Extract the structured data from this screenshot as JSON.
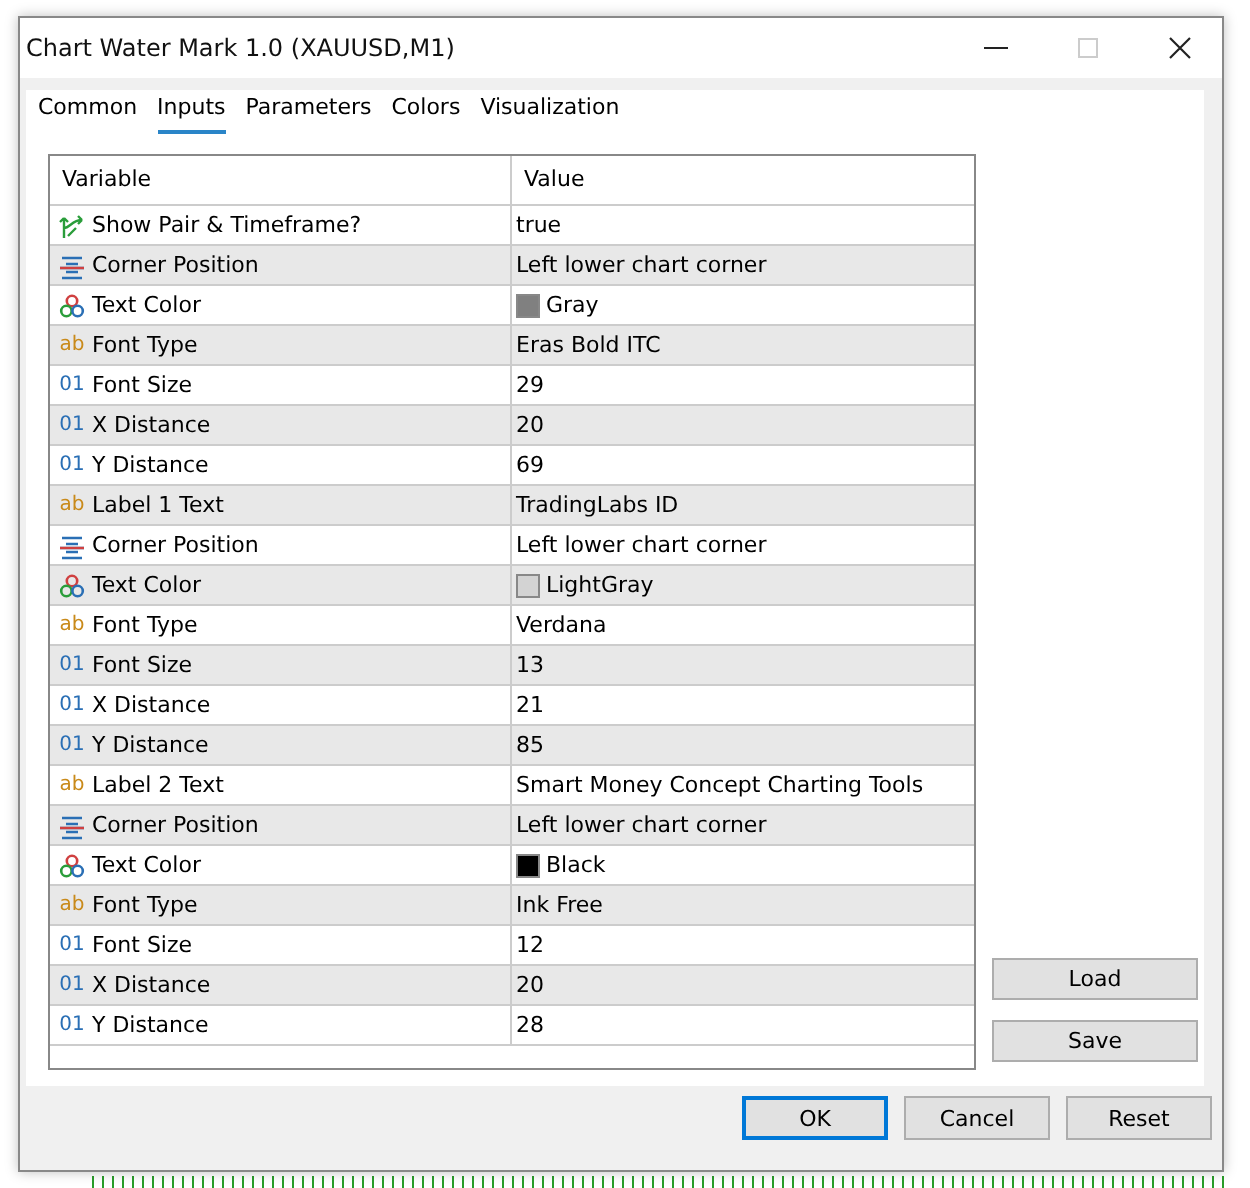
{
  "window": {
    "title": "Chart Water Mark 1.0 (XAUUSD,M1)"
  },
  "tabs": [
    {
      "label": "Common",
      "selected": false
    },
    {
      "label": "Inputs",
      "selected": true
    },
    {
      "label": "Parameters",
      "selected": false
    },
    {
      "label": "Colors",
      "selected": false
    },
    {
      "label": "Visualization",
      "selected": false
    }
  ],
  "table": {
    "columns": [
      "Variable",
      "Value"
    ],
    "rows": [
      {
        "kind": "bool",
        "variable": "Show Pair & Timeframe?",
        "value": "true"
      },
      {
        "kind": "enum",
        "variable": "Corner Position",
        "value": "Left lower chart corner"
      },
      {
        "kind": "color",
        "variable": "Text Color",
        "value": "Gray",
        "color": "#808080"
      },
      {
        "kind": "string",
        "icon": "ab",
        "variable": "Font Type",
        "value": "Eras Bold ITC"
      },
      {
        "kind": "int",
        "icon": "01",
        "variable": "Font Size",
        "value": "29"
      },
      {
        "kind": "int",
        "icon": "01",
        "variable": "X Distance",
        "value": "20"
      },
      {
        "kind": "int",
        "icon": "01",
        "variable": "Y Distance",
        "value": "69"
      },
      {
        "kind": "string",
        "icon": "ab",
        "variable": "Label 1 Text",
        "value": "TradingLabs ID"
      },
      {
        "kind": "enum",
        "variable": "Corner Position",
        "value": "Left lower chart corner"
      },
      {
        "kind": "color",
        "variable": "Text Color",
        "value": "LightGray",
        "color": "#d3d3d3"
      },
      {
        "kind": "string",
        "icon": "ab",
        "variable": "Font Type",
        "value": "Verdana"
      },
      {
        "kind": "int",
        "icon": "01",
        "variable": "Font Size",
        "value": "13"
      },
      {
        "kind": "int",
        "icon": "01",
        "variable": "X Distance",
        "value": "21"
      },
      {
        "kind": "int",
        "icon": "01",
        "variable": "Y Distance",
        "value": "85"
      },
      {
        "kind": "string",
        "icon": "ab",
        "variable": "Label 2 Text",
        "value": "Smart Money Concept Charting Tools"
      },
      {
        "kind": "enum",
        "variable": "Corner Position",
        "value": "Left lower chart corner"
      },
      {
        "kind": "color",
        "variable": "Text Color",
        "value": "Black",
        "color": "#000000"
      },
      {
        "kind": "string",
        "icon": "ab",
        "variable": "Font Type",
        "value": "Ink Free"
      },
      {
        "kind": "int",
        "icon": "01",
        "variable": "Font Size",
        "value": "12"
      },
      {
        "kind": "int",
        "icon": "01",
        "variable": "X Distance",
        "value": "20"
      },
      {
        "kind": "int",
        "icon": "01",
        "variable": "Y Distance",
        "value": "28"
      }
    ]
  },
  "side_buttons": [
    "Load",
    "Save"
  ],
  "buttons": [
    {
      "label": "OK",
      "default": true
    },
    {
      "label": "Cancel",
      "default": false
    },
    {
      "label": "Reset",
      "default": false
    }
  ]
}
